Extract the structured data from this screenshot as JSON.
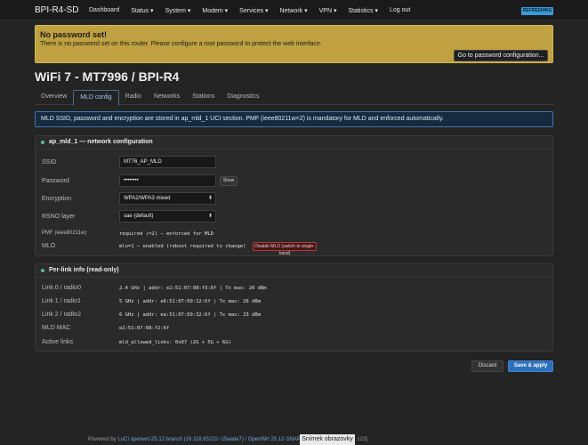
{
  "brand": "BPI-R4-SD",
  "nav": [
    "Dashboard",
    "Status ▾",
    "System ▾",
    "Modem ▾",
    "Services ▾",
    "Network ▾",
    "VPN ▾",
    "Statistics ▾",
    "Log out"
  ],
  "refresh_badge": "REFRESHING",
  "warning": {
    "title": "No password set!",
    "text": "There is no password set on this router. Please configure a root password to protect the web interface.",
    "button": "Go to password configuration..."
  },
  "page_title": "WiFi 7 - MT7996 / BPI-R4",
  "tabs": [
    "Overview",
    "MLD config",
    "Radio",
    "Networks",
    "Stations",
    "Diagnostics"
  ],
  "info_text": "MLD SSID, password and encryption are stored in ap_mld_1 UCI section. PMF (ieee80211w=2) is mandatory for MLD and enforced automatically.",
  "config": {
    "header": "ap_mld_1 — network configuration",
    "ssid_label": "SSID",
    "ssid_value": "MT76_AP_MLD",
    "password_label": "Password",
    "password_value": "••••••••",
    "show_button": "Show",
    "encryption_label": "Encryption",
    "encryption_value": "WPA2/WPA3 mixed",
    "rsno_label": "RSNO layer",
    "rsno_value": "sae (default)",
    "pmf_label": "PMF (ieee80211w)",
    "pmf_value": "required (=2) — enforced for MLD",
    "mlo_label": "MLO",
    "mlo_value": "mlo=1 — enabled (reboot required to change)",
    "mlo_button": "Disable MLO (switch to single-band)"
  },
  "perlink": {
    "header": "Per-link info (read-only)",
    "rows": [
      {
        "label": "Link 0 / radio0",
        "value": "2.4 GHz | addr: e2:51:07:08:f3:6f | Tx max: 20 dBm"
      },
      {
        "label": "Link 1 / radio1",
        "value": "5 GHz | addr: e6:51:07:09:12:6f | Tx max: 26 dBm"
      },
      {
        "label": "Link 2 / radio2",
        "value": "6 GHz | addr: ea:51:07:09:32:6f | Tx max: 23 dBm"
      },
      {
        "label": "MLD MAC",
        "value": "e2:51:07:08:f2:6f"
      },
      {
        "label": "Active links",
        "value": "mld_allowed_links: 0x07 (2G + 5G + 6G)"
      }
    ]
  },
  "buttons": {
    "discard": "Discard",
    "save": "Save & apply"
  },
  "footer": {
    "prefix": "Powered by ",
    "luci": "LuCI openwrt-25.12 branch (26.118.65222~15aabe7)",
    "sep": " / ",
    "openwrt": "OpenWrt 25.12-SNAP",
    "suffix": "c23)"
  },
  "snip_label": "Snímek obrazovky"
}
